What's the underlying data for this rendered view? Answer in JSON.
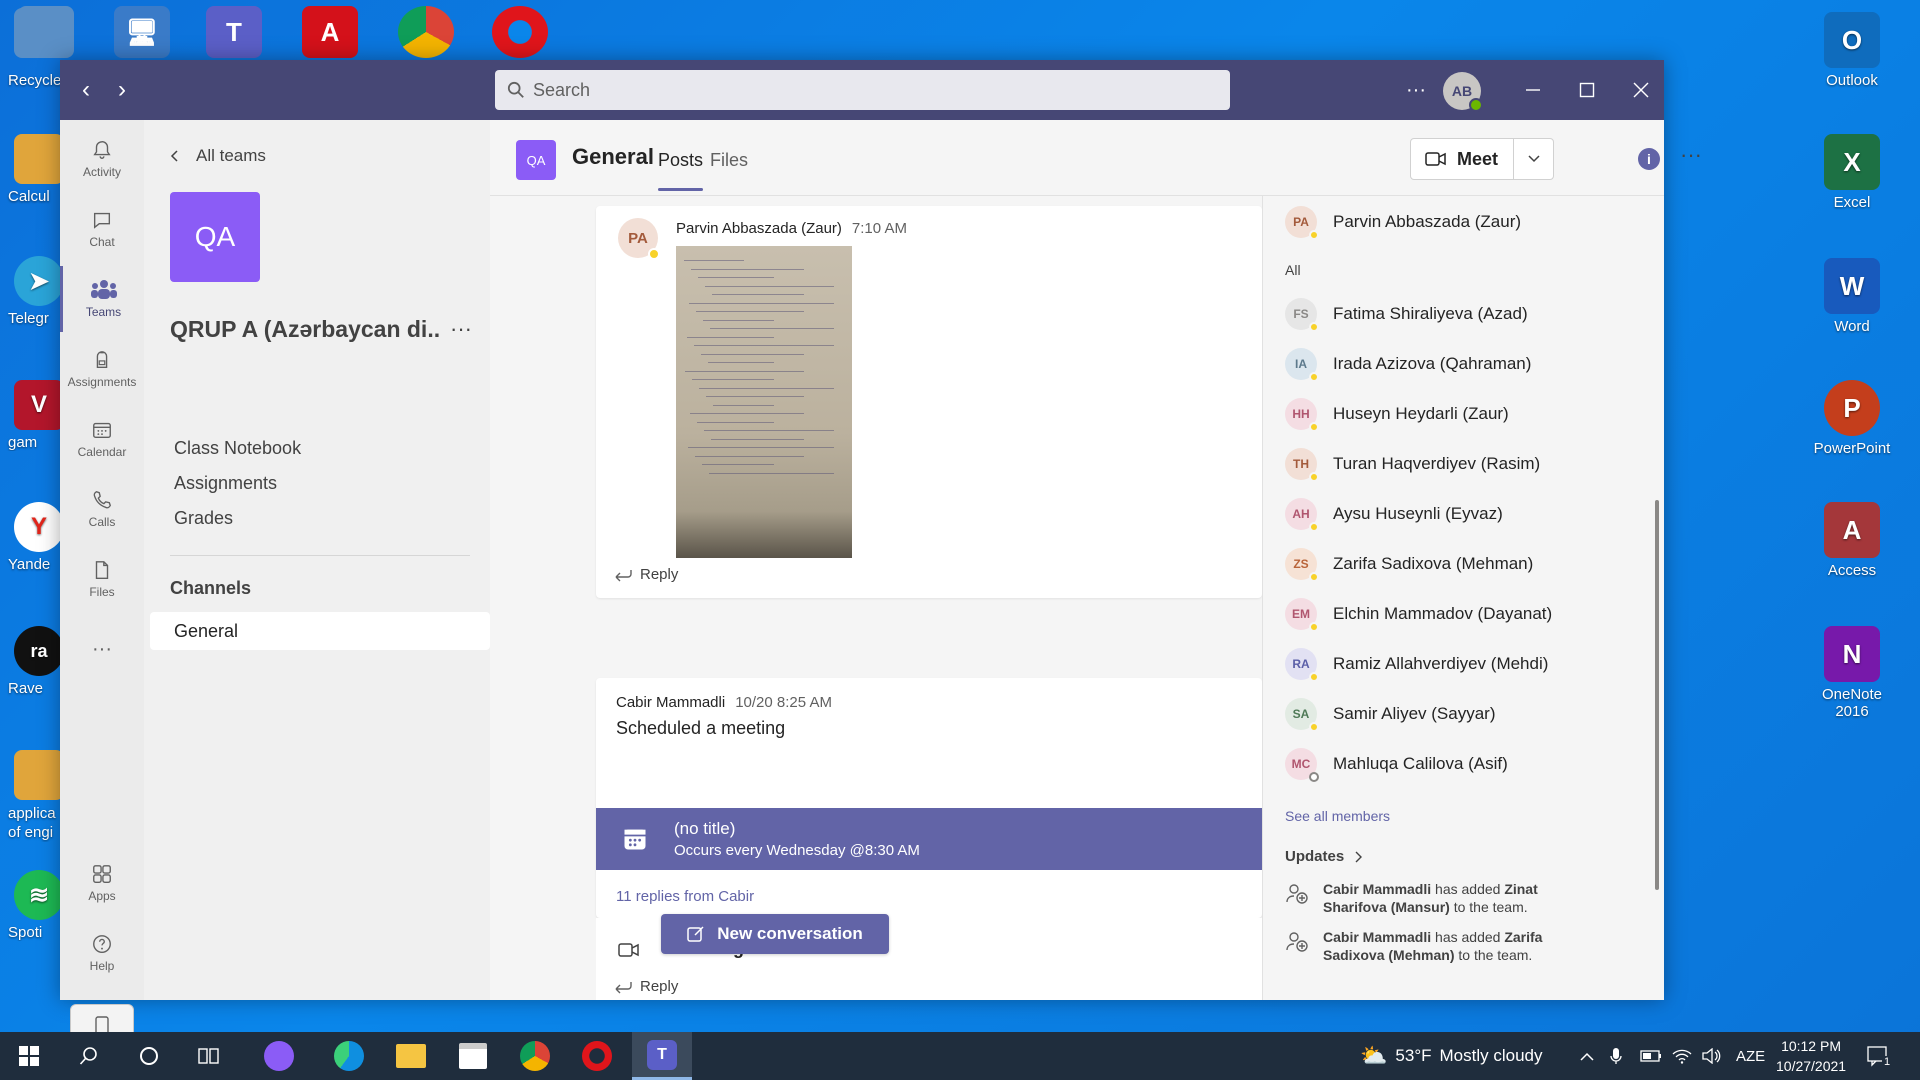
{
  "desktop": {
    "right_icons": [
      {
        "label": "Outlook",
        "letter": "O",
        "color": "#0f6cbd"
      },
      {
        "label": "Excel",
        "letter": "X",
        "color": "#1d7144"
      },
      {
        "label": "Word",
        "letter": "W",
        "color": "#185abd"
      },
      {
        "label": "PowerPoint",
        "letter": "P",
        "color": "#c43e1c"
      },
      {
        "label": "Access",
        "letter": "A",
        "color": "#a4373a"
      },
      {
        "label": "OneNote 2016",
        "letter": "N",
        "color": "#7719aa"
      }
    ],
    "left_icons": [
      {
        "label": "Recycle",
        "color": "#5a8fc6"
      },
      {
        "label": "Calcul",
        "color": "#e0a53b"
      },
      {
        "label": "Telegr",
        "color": "#2aa4d8"
      },
      {
        "label": "gam",
        "color": "#b3162b"
      },
      {
        "label": "Yande",
        "color": "#e1251b"
      },
      {
        "label": "Rave",
        "color": "#111111"
      },
      {
        "label": "applica of engi",
        "color": "#e0a53b"
      },
      {
        "label": "Spoti",
        "color": "#1db954"
      }
    ]
  },
  "window": {
    "search_placeholder": "Search",
    "user_initials": "AB",
    "more_label": "···"
  },
  "rail": {
    "items": [
      {
        "label": "Activity",
        "icon": "bell-icon"
      },
      {
        "label": "Chat",
        "icon": "chat-icon"
      },
      {
        "label": "Teams",
        "icon": "teams-icon"
      },
      {
        "label": "Assignments",
        "icon": "backpack-icon"
      },
      {
        "label": "Calendar",
        "icon": "calendar-icon"
      },
      {
        "label": "Calls",
        "icon": "phone-icon"
      },
      {
        "label": "Files",
        "icon": "file-icon"
      }
    ],
    "more": "···",
    "apps": "Apps",
    "help": "Help"
  },
  "team_panel": {
    "all_teams": "All teams",
    "team_initials": "QA",
    "team_name": "QRUP A (Azərbaycan di...",
    "links": [
      "Class Notebook",
      "Assignments",
      "Grades"
    ],
    "channels_heading": "Channels",
    "channel": "General"
  },
  "channel_header": {
    "initials": "QA",
    "title": "General",
    "tab_posts": "Posts",
    "tab_files": "Files",
    "meet": "Meet"
  },
  "posts": {
    "post1": {
      "initials": "PA",
      "author": "Parvin Abbaszada (Zaur)",
      "time": "7:10 AM",
      "reply": "Reply"
    },
    "post2": {
      "author": "Cabir Mammadli",
      "time": "10/20 8:25 AM",
      "text": "Scheduled a meeting",
      "meeting_title": "(no title)",
      "meeting_sub": "Occurs every Wednesday @8:30 AM",
      "replies_link": "11 replies from Cabir",
      "ended": "Meeting ended: 2h 46m",
      "reply": "Reply"
    },
    "new_conversation": "New conversation"
  },
  "members_panel": {
    "top_member": {
      "initials": "PA",
      "name": "Parvin Abbaszada (Zaur)"
    },
    "all_label": "All",
    "members": [
      {
        "initials": "FS",
        "name": "Fatima Shiraliyeva (Azad)",
        "bg": "#e6e6e6",
        "fg": "#8a8886"
      },
      {
        "initials": "IA",
        "name": "Irada Azizova (Qahraman)",
        "bg": "#dbe6ee",
        "fg": "#5d7a8c"
      },
      {
        "initials": "HH",
        "name": "Huseyn Heydarli (Zaur)",
        "bg": "#f4dde3",
        "fg": "#b0566f"
      },
      {
        "initials": "TH",
        "name": "Turan Haqverdiyev (Rasim)",
        "bg": "#f2dfd6",
        "fg": "#a35a3b"
      },
      {
        "initials": "AH",
        "name": "Aysu Huseynli (Eyvaz)",
        "bg": "#f4dde3",
        "fg": "#b0566f"
      },
      {
        "initials": "ZS",
        "name": "Zarifa Sadixova (Mehman)",
        "bg": "#f6e2d5",
        "fg": "#b9643a"
      },
      {
        "initials": "EM",
        "name": "Elchin Mammadov (Dayanat)",
        "bg": "#f4dde3",
        "fg": "#b0566f"
      },
      {
        "initials": "RA",
        "name": "Ramiz Allahverdiyev (Mehdi)",
        "bg": "#e2e1f3",
        "fg": "#5b5fa8"
      },
      {
        "initials": "SA",
        "name": "Samir Aliyev (Sayyar)",
        "bg": "#e2ebe3",
        "fg": "#4f7a57"
      },
      {
        "initials": "MC",
        "name": "Mahluqa Calilova (Asif)",
        "bg": "#f4dde3",
        "fg": "#b0566f"
      }
    ],
    "see_all": "See all members",
    "updates_heading": "Updates",
    "updates": [
      {
        "actor": "Cabir Mammadli",
        "verb": " has added ",
        "target": "Zinat Sharifova (Mansur)",
        "tail": " to the team."
      },
      {
        "actor": "Cabir Mammadli",
        "verb": " has added ",
        "target": "Zarifa Sadixova (Mehman)",
        "tail": " to the team."
      }
    ]
  },
  "taskbar": {
    "weather_temp": "53°F",
    "weather_desc": "Mostly cloudy",
    "lang": "AZE",
    "time": "10:12 PM",
    "date": "10/27/2021",
    "notifications": "1"
  }
}
